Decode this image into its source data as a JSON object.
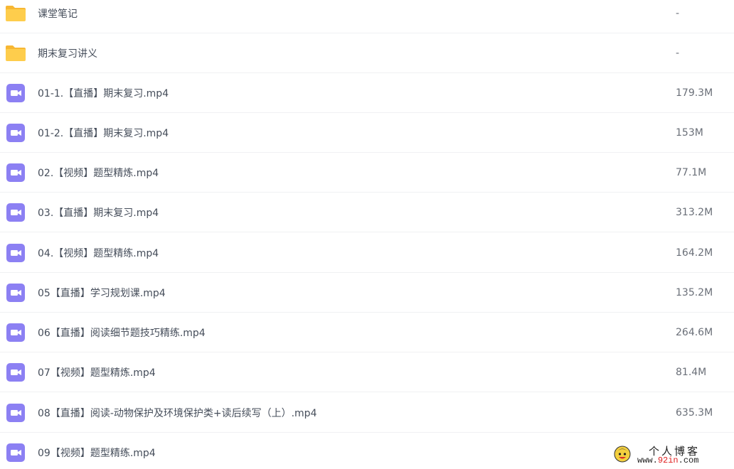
{
  "colors": {
    "folder": "#fecd4c",
    "folder_tab": "#f7b733",
    "video": "#8c80f3",
    "row_divider": "#f0f1f3"
  },
  "files": [
    {
      "name": "课堂笔记",
      "size": "-",
      "icon": "folder-icon",
      "type": "folder"
    },
    {
      "name": "期末复习讲义",
      "size": "-",
      "icon": "folder-icon",
      "type": "folder"
    },
    {
      "name": "01-1.【直播】期末复习.mp4",
      "size": "179.3M",
      "icon": "video-file-icon",
      "type": "video"
    },
    {
      "name": "01-2.【直播】期末复习.mp4",
      "size": "153M",
      "icon": "video-file-icon",
      "type": "video"
    },
    {
      "name": "02.【视频】题型精炼.mp4",
      "size": "77.1M",
      "icon": "video-file-icon",
      "type": "video"
    },
    {
      "name": "03.【直播】期末复习.mp4",
      "size": "313.2M",
      "icon": "video-file-icon",
      "type": "video"
    },
    {
      "name": "04.【视频】题型精练.mp4",
      "size": "164.2M",
      "icon": "video-file-icon",
      "type": "video"
    },
    {
      "name": "05【直播】学习规划课.mp4",
      "size": "135.2M",
      "icon": "video-file-icon",
      "type": "video"
    },
    {
      "name": "06【直播】阅读细节题技巧精练.mp4",
      "size": "264.6M",
      "icon": "video-file-icon",
      "type": "video"
    },
    {
      "name": "07【视频】题型精炼.mp4",
      "size": "81.4M",
      "icon": "video-file-icon",
      "type": "video"
    },
    {
      "name": "08【直播】阅读-动物保护及环境保护类+读后续写（上）.mp4",
      "size": "635.3M",
      "icon": "video-file-icon",
      "type": "video"
    },
    {
      "name": "09【视频】题型精练.mp4",
      "size": "",
      "icon": "video-file-icon",
      "type": "video"
    }
  ],
  "watermark": {
    "title": "个人博客",
    "url_prefix": "www.",
    "url_highlight": "92in",
    "url_suffix": ".com",
    "icon": "mascot-icon"
  }
}
